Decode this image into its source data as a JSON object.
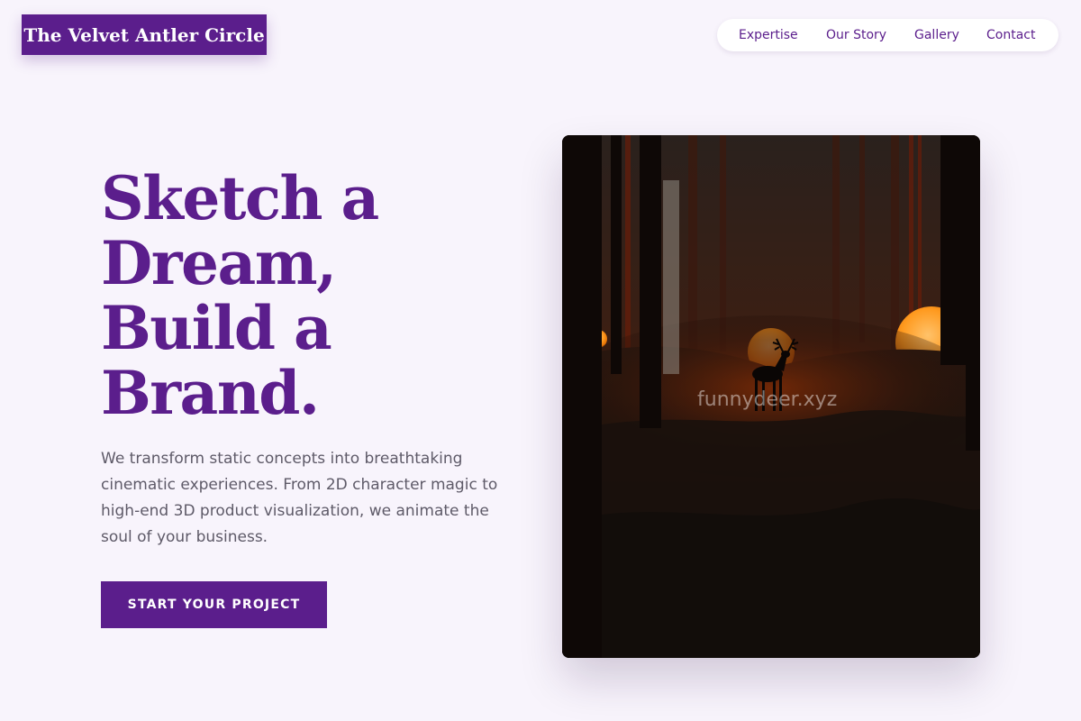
{
  "brand": {
    "name": "The Velvet Antler Circle",
    "color": "#5b1e8c"
  },
  "nav": {
    "items": [
      {
        "label": "Expertise"
      },
      {
        "label": "Our Story"
      },
      {
        "label": "Gallery"
      },
      {
        "label": "Contact"
      }
    ]
  },
  "hero": {
    "headline_lines": [
      "Sketch a",
      "Dream,",
      "Build a",
      "Brand."
    ],
    "description": "We transform static concepts into breathtaking cinematic experiences. From 2D character magic to high-end 3D product visualization, we animate the soul of your business.",
    "cta_label": "START YOUR PROJECT",
    "image": {
      "subject": "deer silhouette in dark forest with orange glowing orbs",
      "watermark": "funnydeer.xyz"
    }
  }
}
